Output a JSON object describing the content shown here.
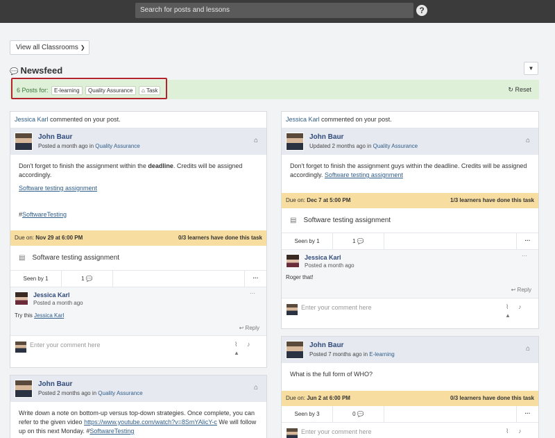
{
  "header": {
    "search_placeholder": "Search for posts and lessons",
    "help_label": "?"
  },
  "toolbar": {
    "view_label": "View all Classrooms",
    "filter_icon": "funnel-icon"
  },
  "newsfeed": {
    "title": "Newsfeed"
  },
  "filterbar": {
    "count_text": "6 Posts for:",
    "chips": [
      "E-learning",
      "Quality Assurance",
      "Task"
    ],
    "reset_label": "Reset"
  },
  "posts": [
    {
      "notify_user": "Jessica Karl",
      "notify_text": " commented on your post.",
      "author": "John Baur",
      "meta_prefix": "Posted a month ago in ",
      "classroom": "Quality Assurance",
      "body_pre": "Don't forget to finish the assignment within the ",
      "body_bold": "deadline",
      "body_post": ". Credits will be assigned accordingly.",
      "link": "Software testing assignment",
      "hashtag_prefix": "#",
      "hashtag": "SoftwareTesting",
      "due_label": "Due on: ",
      "due_date": "Nov 29 at 6:00 PM",
      "learners": "0/3 learners have done this task",
      "task": "Software testing assignment",
      "seen": "Seen by 1",
      "comments": "1",
      "comment": {
        "author": "Jessica Karl",
        "meta": "Posted a month ago",
        "text_pre": "Try this ",
        "text_link": "Jessica Karl",
        "reply": "Reply"
      },
      "composer_placeholder": "Enter your comment here"
    },
    {
      "notify_user": "Jessica Karl",
      "notify_text": " commented on your post.",
      "author": "John Baur",
      "meta_prefix": "Updated 2 months ago in ",
      "classroom": "Quality Assurance",
      "body_pre": "Don't forget to finish the assignment guys within the deadline. Credits will be assigned accordingly. ",
      "link": "Software testing assignment",
      "due_label": "Due on: ",
      "due_date": "Dec 7 at 5:00 PM",
      "learners": "1/3 learners have done this task",
      "task": "Software testing assignment",
      "seen": "Seen by 1",
      "comments": "1",
      "comment": {
        "author": "Jessica Karl",
        "meta": "Posted a month ago",
        "text": "Roger that!",
        "reply": "Reply"
      },
      "composer_placeholder": "Enter your comment here"
    },
    {
      "author": "John Baur",
      "meta_prefix": "Posted 2 months ago in ",
      "classroom": "Quality Assurance",
      "body_pre": "Write down a note on bottom-up versus top-down strategies. Once complete, you can refer to the given video ",
      "link": "https://www.youtube.com/watch?v=8SmYAlicY-c",
      "body_post": " We will follow up on this next Monday. #",
      "hashtag": "SoftwareTesting"
    },
    {
      "author": "John Baur",
      "meta_prefix": "Posted 7 months ago in ",
      "classroom": "E-learning",
      "body": "What is the full form of WHO?",
      "due_label": "Due on: ",
      "due_date": "Jun 2 at 6:00 PM",
      "learners": "0/3 learners have done this task",
      "seen": "Seen by 3",
      "comments": "0",
      "composer_placeholder": "Enter your comment here"
    }
  ]
}
